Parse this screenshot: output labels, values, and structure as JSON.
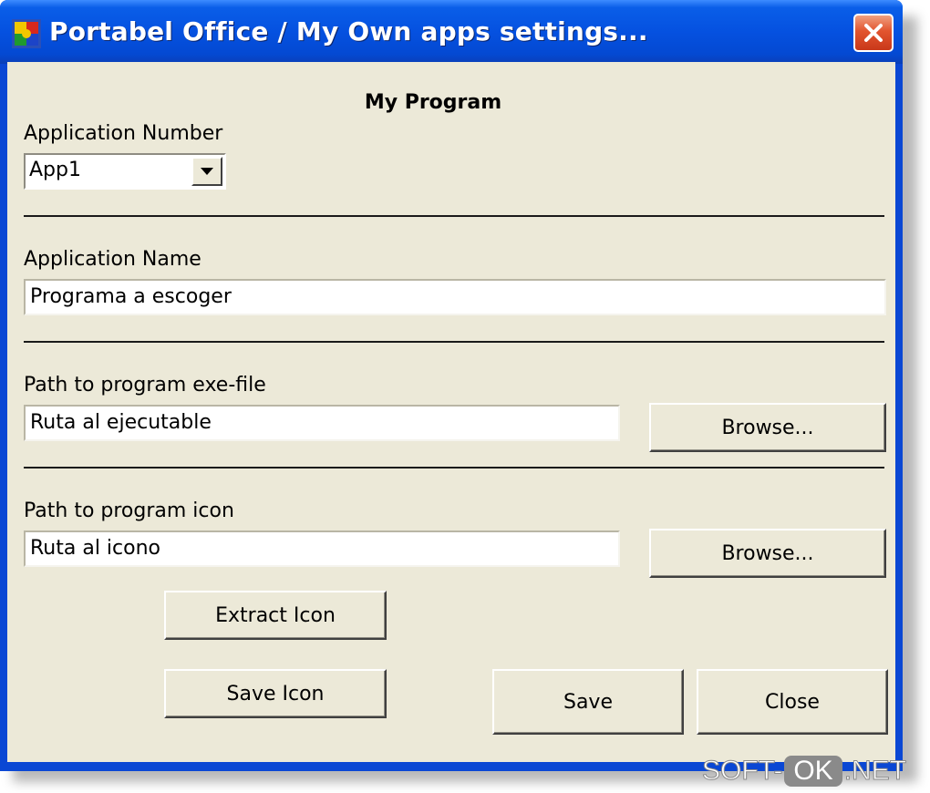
{
  "window": {
    "title": "Portabel Office / My Own apps settings...",
    "app_icon": "colored-blocks-icon",
    "close_icon": "close-icon"
  },
  "form": {
    "heading": "My Program",
    "app_number_label": "Application Number",
    "app_number_value": "App1",
    "app_name_label": "Application Name",
    "app_name_value": "Programa a escoger",
    "exe_path_label": "Path to program exe-file",
    "exe_path_value": "Ruta al ejecutable",
    "icon_path_label": "Path to program icon",
    "icon_path_value": "Ruta al icono"
  },
  "buttons": {
    "browse_exe": "Browse...",
    "browse_icon": "Browse...",
    "extract_icon": "Extract Icon",
    "save_icon": "Save Icon",
    "save": "Save",
    "close": "Close"
  },
  "watermark": {
    "left": "SOFT-",
    "middle": "OK",
    "right": ".NET"
  },
  "colors": {
    "titlebar": "#0551e0",
    "client": "#ece9d8",
    "close_button": "#e2542e"
  }
}
